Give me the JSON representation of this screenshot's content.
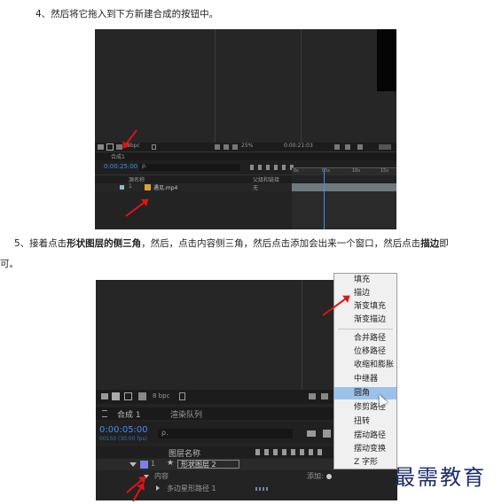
{
  "steps": {
    "step4": "4、然后将它拖入到下方新建合成的按钮中。",
    "step5": {
      "p1": "5、接着点击",
      "p2": "形状图层的侧三角",
      "p3": "，然后，点击内容侧三角，然后点击添加会出来一个窗口，然后点击",
      "p4": "描边",
      "p5": "即",
      "p6": "可。"
    }
  },
  "screenshot1": {
    "bpc": "8bpc",
    "zoom": "25%",
    "time_readout": "0:00:21:03",
    "comp_tab": "合成1",
    "timecode": "0:00:25:00",
    "search_placeholder": "ρ.",
    "col_source": "源名称",
    "col_parent": "父级和链接",
    "layer_index": "1",
    "layer_name": "遇见.mp4",
    "parent_value": "无",
    "ruler": [
      "0s",
      "05s",
      "10s",
      "15s"
    ]
  },
  "screenshot2": {
    "bpc": "8 bpc",
    "comp_tab": "合成 1",
    "render_tab": "渲染队列",
    "timecode": "0:00:05:00",
    "timecode_sub": "00150 (30.00 fps)",
    "search_placeholder": "ρ.",
    "col_layer_name": "图层名称",
    "layer_index": "1",
    "layer_name": "形状图层 2",
    "sub_content": "内容",
    "add_label": "添加:",
    "sub_polygon": "多边星形路径 1",
    "menu": [
      "填充",
      "描边",
      "渐变填充",
      "渐变描边",
      "合并路径",
      "位移路径",
      "收缩和膨胀",
      "中继器",
      "圆角",
      "修剪路径",
      "扭转",
      "摆动路径",
      "摆动变换",
      "Z 字形"
    ],
    "menu_highlight": "圆角"
  },
  "watermark": "最需教育",
  "colors": {
    "arrow": "#e01414",
    "menu_highlight": "#9bc3ea",
    "timecode_blue": "#3d8ff0",
    "label_purple": "#7f7fe8"
  }
}
